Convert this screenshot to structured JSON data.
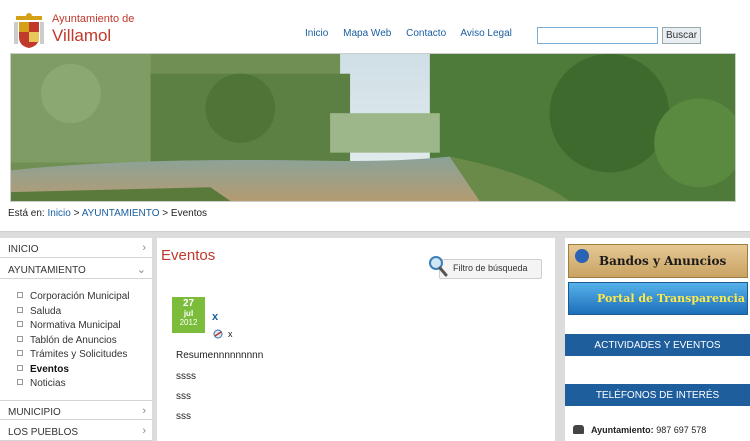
{
  "header": {
    "subtitle": "Ayuntamiento de",
    "title": "Villamol",
    "nav": [
      "Inicio",
      "Mapa Web",
      "Contacto",
      "Aviso Legal"
    ],
    "search_value": "",
    "search_button": "Buscar"
  },
  "breadcrumb": {
    "prefix": "Está en:",
    "links": [
      "Inicio",
      "AYUNTAMIENTO"
    ],
    "sep": ">",
    "current": "Eventos"
  },
  "sidebar": {
    "items": [
      {
        "label": "INICIO",
        "chevron": "›"
      },
      {
        "label": "AYUNTAMIENTO",
        "chevron": "⌄"
      },
      {
        "label": "MUNICIPIO",
        "chevron": "›"
      },
      {
        "label": "LOS PUEBLOS",
        "chevron": "›"
      }
    ],
    "subitems": [
      {
        "label": "Corporación Municipal"
      },
      {
        "label": "Saluda"
      },
      {
        "label": "Normativa Municipal"
      },
      {
        "label": "Tablón de Anuncios"
      },
      {
        "label": "Trámites y Solicitudes"
      },
      {
        "label": "Eventos"
      },
      {
        "label": "Noticias"
      }
    ]
  },
  "main": {
    "title": "Eventos",
    "filter_label": "Filtro de búsqueda",
    "event": {
      "day": "27",
      "month": "jul",
      "year": "2012",
      "title": "x",
      "tag": "x",
      "lines": [
        "Resumennnnnnnnn",
        "ssss",
        "sss",
        "sss"
      ]
    }
  },
  "right": {
    "banner1": "Bandos y Anuncios",
    "banner2": "Portal de Transparencia",
    "section1": "ACTIVIDADES Y EVENTOS",
    "section2": "TELÉFONOS DE INTERÉS",
    "phone_label": "Ayuntamiento:",
    "phone_number": "987 697 578"
  },
  "colors": {
    "accent": "#c0392b",
    "link": "#1a5ea0",
    "date_green": "#7bbd3a",
    "section_blue": "#1f5e9d"
  }
}
